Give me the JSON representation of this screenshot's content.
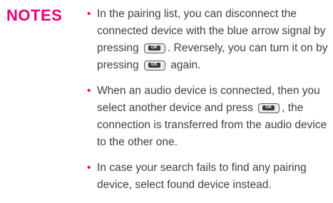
{
  "heading": "NOTES",
  "colors": {
    "accent": "#e6007e",
    "body_text": "#414141"
  },
  "icons": {
    "bullet": "bullet-dot",
    "ok_key": "ok-key-icon"
  },
  "ok_key_label": "OK",
  "notes": [
    {
      "part1": "In the pairing list, you can disconnect the connected device with the blue arrow signal by pressing",
      "part2": ". Reversely, you can turn it on by pressing",
      "part3": "again."
    },
    {
      "part1": "When an audio device is connected, then you select another device and press",
      "part2": ", the connection is transferred from the audio device to the other one."
    },
    {
      "part1": "In case your search fails to find any pairing device, select found device instead."
    }
  ]
}
